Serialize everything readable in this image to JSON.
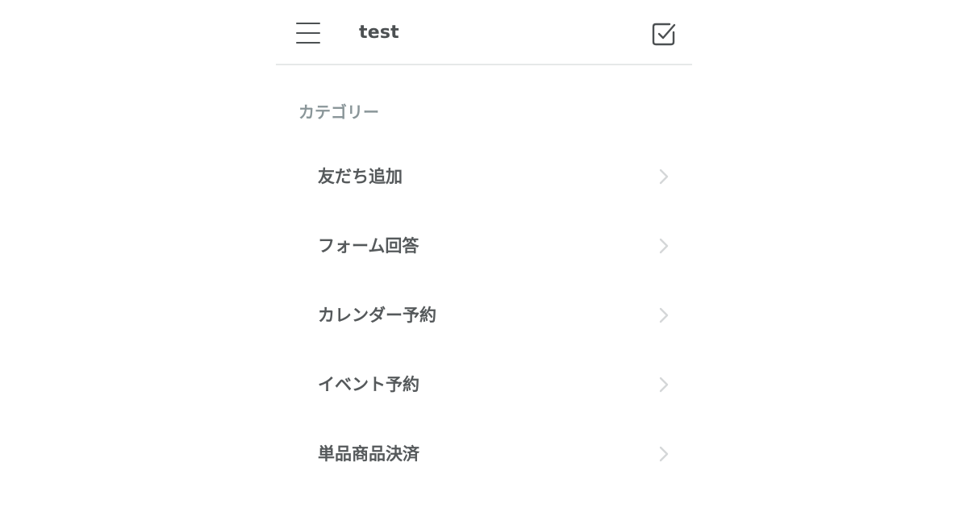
{
  "header": {
    "title": "test",
    "menu_icon": "hamburger-menu-icon",
    "action_icon": "checkbox-compose-icon"
  },
  "categories": {
    "label": "カテゴリー",
    "items": [
      {
        "label": "友だち追加"
      },
      {
        "label": "フォーム回答"
      },
      {
        "label": "カレンダー予約"
      },
      {
        "label": "イベント予約"
      },
      {
        "label": "単品商品決済"
      }
    ]
  },
  "colors": {
    "title_text": "#4c5052",
    "section_label": "#8a9699",
    "item_text": "#55595b",
    "chevron": "#d4d7d8",
    "divider": "#e6e8e8",
    "icon": "#4c5052"
  }
}
